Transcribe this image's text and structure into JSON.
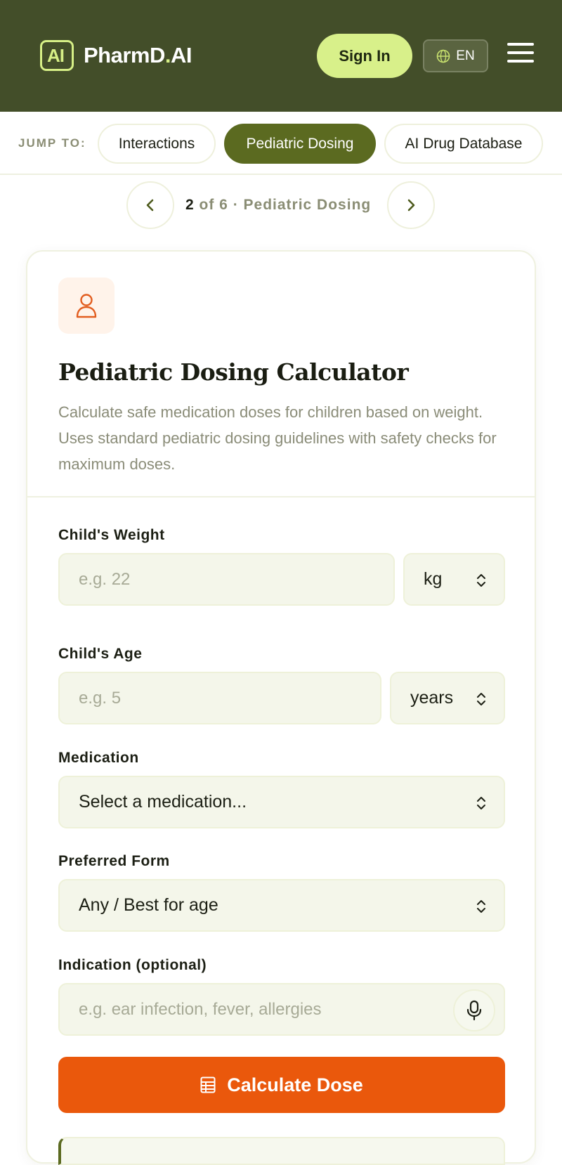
{
  "header": {
    "logo_mark": "AI",
    "logo_text_main": "PharmD",
    "logo_text_dot": ".",
    "logo_text_tail": "AI",
    "signin_label": "Sign In",
    "language": "EN",
    "globe_icon": "globe-icon",
    "menu_icon": "hamburger-menu-icon"
  },
  "jump": {
    "label": "JUMP TO:",
    "chips": [
      {
        "label": "Interactions",
        "active": false
      },
      {
        "label": "Pediatric Dosing",
        "active": true
      },
      {
        "label": "AI Drug Database",
        "active": false
      }
    ]
  },
  "pager": {
    "current": "2",
    "rest": " of 6 · Pediatric Dosing",
    "prev_icon": "chevron-left-icon",
    "next_icon": "chevron-right-icon"
  },
  "card": {
    "icon": "person-icon",
    "title": "Pediatric Dosing Calculator",
    "description": "Calculate safe medication doses for children based on weight. Uses standard pediatric dosing guidelines with safety checks for maximum doses."
  },
  "form": {
    "weight": {
      "label": "Child's Weight",
      "placeholder": "e.g. 22",
      "unit": "kg"
    },
    "age": {
      "label": "Child's Age",
      "placeholder": "e.g. 5",
      "unit": "years"
    },
    "medication": {
      "label": "Medication",
      "value": "Select a medication..."
    },
    "form_pref": {
      "label": "Preferred Form",
      "value": "Any / Best for age"
    },
    "indication": {
      "label": "Indication (optional)",
      "placeholder": "e.g. ear infection, fever, allergies",
      "mic_icon": "microphone-icon"
    },
    "submit_label": "Calculate Dose",
    "submit_icon": "table-icon"
  },
  "colors": {
    "header_bg": "#434e29",
    "accent_lime": "#d8f08a",
    "active_chip": "#5b6a20",
    "cta_orange": "#ea580c"
  }
}
